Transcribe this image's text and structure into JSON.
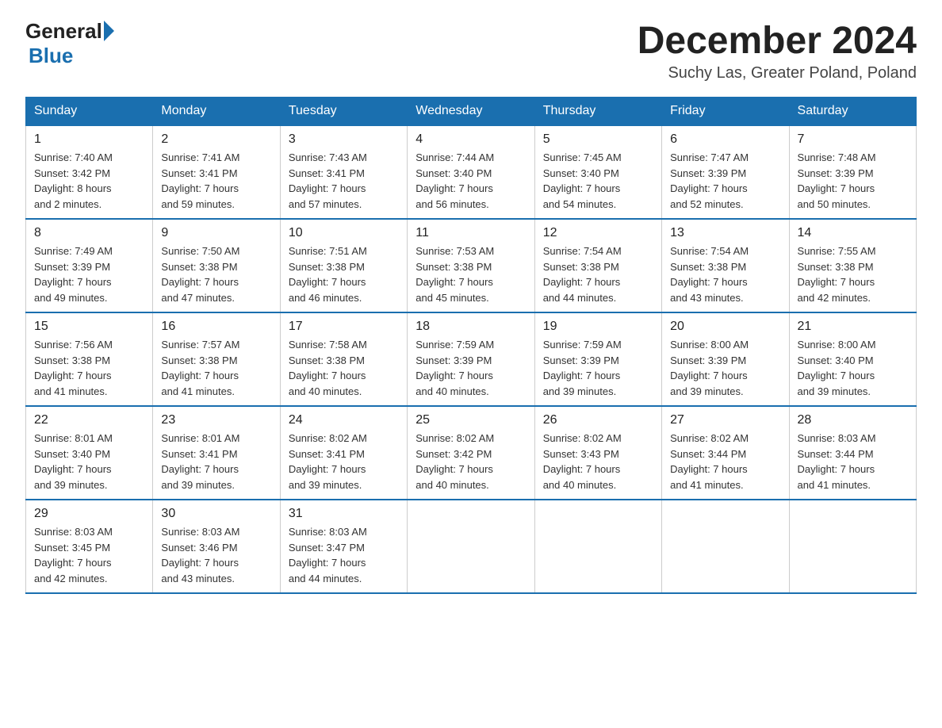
{
  "header": {
    "logo_general": "General",
    "logo_blue": "Blue",
    "month_year": "December 2024",
    "location": "Suchy Las, Greater Poland, Poland"
  },
  "days_of_week": [
    "Sunday",
    "Monday",
    "Tuesday",
    "Wednesday",
    "Thursday",
    "Friday",
    "Saturday"
  ],
  "weeks": [
    [
      {
        "day": "1",
        "sunrise": "7:40 AM",
        "sunset": "3:42 PM",
        "daylight": "8 hours and 2 minutes."
      },
      {
        "day": "2",
        "sunrise": "7:41 AM",
        "sunset": "3:41 PM",
        "daylight": "7 hours and 59 minutes."
      },
      {
        "day": "3",
        "sunrise": "7:43 AM",
        "sunset": "3:41 PM",
        "daylight": "7 hours and 57 minutes."
      },
      {
        "day": "4",
        "sunrise": "7:44 AM",
        "sunset": "3:40 PM",
        "daylight": "7 hours and 56 minutes."
      },
      {
        "day": "5",
        "sunrise": "7:45 AM",
        "sunset": "3:40 PM",
        "daylight": "7 hours and 54 minutes."
      },
      {
        "day": "6",
        "sunrise": "7:47 AM",
        "sunset": "3:39 PM",
        "daylight": "7 hours and 52 minutes."
      },
      {
        "day": "7",
        "sunrise": "7:48 AM",
        "sunset": "3:39 PM",
        "daylight": "7 hours and 50 minutes."
      }
    ],
    [
      {
        "day": "8",
        "sunrise": "7:49 AM",
        "sunset": "3:39 PM",
        "daylight": "7 hours and 49 minutes."
      },
      {
        "day": "9",
        "sunrise": "7:50 AM",
        "sunset": "3:38 PM",
        "daylight": "7 hours and 47 minutes."
      },
      {
        "day": "10",
        "sunrise": "7:51 AM",
        "sunset": "3:38 PM",
        "daylight": "7 hours and 46 minutes."
      },
      {
        "day": "11",
        "sunrise": "7:53 AM",
        "sunset": "3:38 PM",
        "daylight": "7 hours and 45 minutes."
      },
      {
        "day": "12",
        "sunrise": "7:54 AM",
        "sunset": "3:38 PM",
        "daylight": "7 hours and 44 minutes."
      },
      {
        "day": "13",
        "sunrise": "7:54 AM",
        "sunset": "3:38 PM",
        "daylight": "7 hours and 43 minutes."
      },
      {
        "day": "14",
        "sunrise": "7:55 AM",
        "sunset": "3:38 PM",
        "daylight": "7 hours and 42 minutes."
      }
    ],
    [
      {
        "day": "15",
        "sunrise": "7:56 AM",
        "sunset": "3:38 PM",
        "daylight": "7 hours and 41 minutes."
      },
      {
        "day": "16",
        "sunrise": "7:57 AM",
        "sunset": "3:38 PM",
        "daylight": "7 hours and 41 minutes."
      },
      {
        "day": "17",
        "sunrise": "7:58 AM",
        "sunset": "3:38 PM",
        "daylight": "7 hours and 40 minutes."
      },
      {
        "day": "18",
        "sunrise": "7:59 AM",
        "sunset": "3:39 PM",
        "daylight": "7 hours and 40 minutes."
      },
      {
        "day": "19",
        "sunrise": "7:59 AM",
        "sunset": "3:39 PM",
        "daylight": "7 hours and 39 minutes."
      },
      {
        "day": "20",
        "sunrise": "8:00 AM",
        "sunset": "3:39 PM",
        "daylight": "7 hours and 39 minutes."
      },
      {
        "day": "21",
        "sunrise": "8:00 AM",
        "sunset": "3:40 PM",
        "daylight": "7 hours and 39 minutes."
      }
    ],
    [
      {
        "day": "22",
        "sunrise": "8:01 AM",
        "sunset": "3:40 PM",
        "daylight": "7 hours and 39 minutes."
      },
      {
        "day": "23",
        "sunrise": "8:01 AM",
        "sunset": "3:41 PM",
        "daylight": "7 hours and 39 minutes."
      },
      {
        "day": "24",
        "sunrise": "8:02 AM",
        "sunset": "3:41 PM",
        "daylight": "7 hours and 39 minutes."
      },
      {
        "day": "25",
        "sunrise": "8:02 AM",
        "sunset": "3:42 PM",
        "daylight": "7 hours and 40 minutes."
      },
      {
        "day": "26",
        "sunrise": "8:02 AM",
        "sunset": "3:43 PM",
        "daylight": "7 hours and 40 minutes."
      },
      {
        "day": "27",
        "sunrise": "8:02 AM",
        "sunset": "3:44 PM",
        "daylight": "7 hours and 41 minutes."
      },
      {
        "day": "28",
        "sunrise": "8:03 AM",
        "sunset": "3:44 PM",
        "daylight": "7 hours and 41 minutes."
      }
    ],
    [
      {
        "day": "29",
        "sunrise": "8:03 AM",
        "sunset": "3:45 PM",
        "daylight": "7 hours and 42 minutes."
      },
      {
        "day": "30",
        "sunrise": "8:03 AM",
        "sunset": "3:46 PM",
        "daylight": "7 hours and 43 minutes."
      },
      {
        "day": "31",
        "sunrise": "8:03 AM",
        "sunset": "3:47 PM",
        "daylight": "7 hours and 44 minutes."
      },
      null,
      null,
      null,
      null
    ]
  ],
  "labels": {
    "sunrise": "Sunrise:",
    "sunset": "Sunset:",
    "daylight": "Daylight:"
  }
}
